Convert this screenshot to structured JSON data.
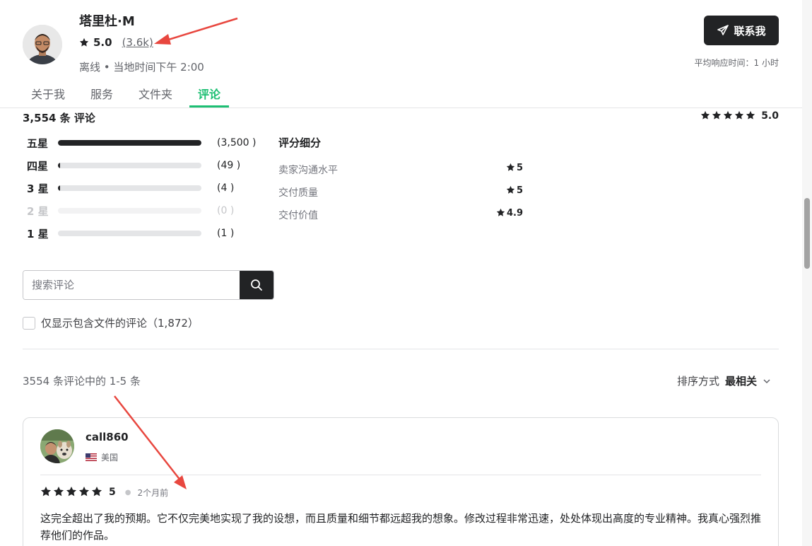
{
  "seller": {
    "name": "塔里杜·M",
    "rating": "5.0",
    "review_count": "(3.6k)",
    "status": "离线 • 当地时间下午 2:00"
  },
  "contact": {
    "label": "联系我",
    "response_time": "平均响应时间：1 小时"
  },
  "tabs": [
    {
      "label": "关于我",
      "active": false
    },
    {
      "label": "服务",
      "active": false
    },
    {
      "label": "文件夹",
      "active": false
    },
    {
      "label": "评论",
      "active": true
    }
  ],
  "summary": {
    "title": "3,554 条 评论",
    "overall": "5.0",
    "bars": [
      {
        "label": "五星",
        "count": "(3,500 )",
        "fraction": 1.0,
        "disabled": false
      },
      {
        "label": "四星",
        "count": "(49 )",
        "fraction": 0.014,
        "disabled": false
      },
      {
        "label": "3 星",
        "count": "(4 )",
        "fraction": 0.005,
        "disabled": false
      },
      {
        "label": "2 星",
        "count": "(0 )",
        "fraction": 0,
        "disabled": true
      },
      {
        "label": "1 星",
        "count": "(1 )",
        "fraction": 0.0,
        "disabled": false
      }
    ],
    "breakdown_title": "评分细分",
    "breakdown": [
      {
        "label": "卖家沟通水平",
        "value": "5"
      },
      {
        "label": "交付质量",
        "value": "5"
      },
      {
        "label": "交付价值",
        "value": "4.9"
      }
    ]
  },
  "search": {
    "placeholder": "搜索评论"
  },
  "filter": {
    "label": "仅显示包含文件的评论（1,872）"
  },
  "listing": {
    "range_text": "3554 条评论中的 1-5 条",
    "sort_label": "排序方式",
    "sort_value": "最相关"
  },
  "review": {
    "name": "call860",
    "country": "美国",
    "rating": "5",
    "ago": "2个月前",
    "text": "这完全超出了我的预期。它不仅完美地实现了我的设想，而且质量和细节都远超我的想象。修改过程非常迅速，处处体现出高度的专业精神。我真心强烈推荐他们的作品。"
  },
  "icons": {
    "star": "star-icon",
    "send": "send-icon",
    "search": "search-icon",
    "chevron": "chevron-down-icon"
  },
  "colors": {
    "accent": "#1dbf73",
    "dark": "#222325",
    "arrow": "#e8473f"
  }
}
